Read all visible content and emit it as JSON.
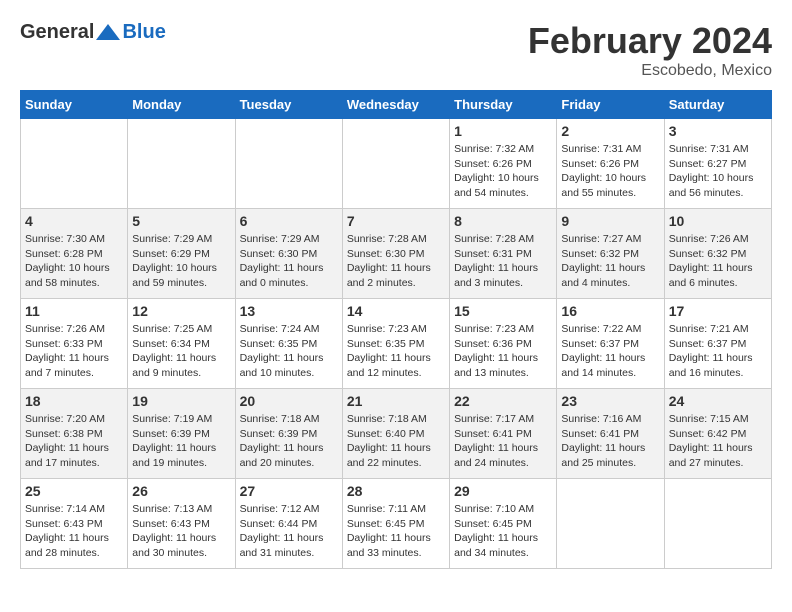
{
  "header": {
    "logo_general": "General",
    "logo_blue": "Blue",
    "month_year": "February 2024",
    "location": "Escobedo, Mexico"
  },
  "days_of_week": [
    "Sunday",
    "Monday",
    "Tuesday",
    "Wednesday",
    "Thursday",
    "Friday",
    "Saturday"
  ],
  "weeks": [
    [
      {
        "day": "",
        "info": ""
      },
      {
        "day": "",
        "info": ""
      },
      {
        "day": "",
        "info": ""
      },
      {
        "day": "",
        "info": ""
      },
      {
        "day": "1",
        "info": "Sunrise: 7:32 AM\nSunset: 6:26 PM\nDaylight: 10 hours and 54 minutes."
      },
      {
        "day": "2",
        "info": "Sunrise: 7:31 AM\nSunset: 6:26 PM\nDaylight: 10 hours and 55 minutes."
      },
      {
        "day": "3",
        "info": "Sunrise: 7:31 AM\nSunset: 6:27 PM\nDaylight: 10 hours and 56 minutes."
      }
    ],
    [
      {
        "day": "4",
        "info": "Sunrise: 7:30 AM\nSunset: 6:28 PM\nDaylight: 10 hours and 58 minutes."
      },
      {
        "day": "5",
        "info": "Sunrise: 7:29 AM\nSunset: 6:29 PM\nDaylight: 10 hours and 59 minutes."
      },
      {
        "day": "6",
        "info": "Sunrise: 7:29 AM\nSunset: 6:30 PM\nDaylight: 11 hours and 0 minutes."
      },
      {
        "day": "7",
        "info": "Sunrise: 7:28 AM\nSunset: 6:30 PM\nDaylight: 11 hours and 2 minutes."
      },
      {
        "day": "8",
        "info": "Sunrise: 7:28 AM\nSunset: 6:31 PM\nDaylight: 11 hours and 3 minutes."
      },
      {
        "day": "9",
        "info": "Sunrise: 7:27 AM\nSunset: 6:32 PM\nDaylight: 11 hours and 4 minutes."
      },
      {
        "day": "10",
        "info": "Sunrise: 7:26 AM\nSunset: 6:32 PM\nDaylight: 11 hours and 6 minutes."
      }
    ],
    [
      {
        "day": "11",
        "info": "Sunrise: 7:26 AM\nSunset: 6:33 PM\nDaylight: 11 hours and 7 minutes."
      },
      {
        "day": "12",
        "info": "Sunrise: 7:25 AM\nSunset: 6:34 PM\nDaylight: 11 hours and 9 minutes."
      },
      {
        "day": "13",
        "info": "Sunrise: 7:24 AM\nSunset: 6:35 PM\nDaylight: 11 hours and 10 minutes."
      },
      {
        "day": "14",
        "info": "Sunrise: 7:23 AM\nSunset: 6:35 PM\nDaylight: 11 hours and 12 minutes."
      },
      {
        "day": "15",
        "info": "Sunrise: 7:23 AM\nSunset: 6:36 PM\nDaylight: 11 hours and 13 minutes."
      },
      {
        "day": "16",
        "info": "Sunrise: 7:22 AM\nSunset: 6:37 PM\nDaylight: 11 hours and 14 minutes."
      },
      {
        "day": "17",
        "info": "Sunrise: 7:21 AM\nSunset: 6:37 PM\nDaylight: 11 hours and 16 minutes."
      }
    ],
    [
      {
        "day": "18",
        "info": "Sunrise: 7:20 AM\nSunset: 6:38 PM\nDaylight: 11 hours and 17 minutes."
      },
      {
        "day": "19",
        "info": "Sunrise: 7:19 AM\nSunset: 6:39 PM\nDaylight: 11 hours and 19 minutes."
      },
      {
        "day": "20",
        "info": "Sunrise: 7:18 AM\nSunset: 6:39 PM\nDaylight: 11 hours and 20 minutes."
      },
      {
        "day": "21",
        "info": "Sunrise: 7:18 AM\nSunset: 6:40 PM\nDaylight: 11 hours and 22 minutes."
      },
      {
        "day": "22",
        "info": "Sunrise: 7:17 AM\nSunset: 6:41 PM\nDaylight: 11 hours and 24 minutes."
      },
      {
        "day": "23",
        "info": "Sunrise: 7:16 AM\nSunset: 6:41 PM\nDaylight: 11 hours and 25 minutes."
      },
      {
        "day": "24",
        "info": "Sunrise: 7:15 AM\nSunset: 6:42 PM\nDaylight: 11 hours and 27 minutes."
      }
    ],
    [
      {
        "day": "25",
        "info": "Sunrise: 7:14 AM\nSunset: 6:43 PM\nDaylight: 11 hours and 28 minutes."
      },
      {
        "day": "26",
        "info": "Sunrise: 7:13 AM\nSunset: 6:43 PM\nDaylight: 11 hours and 30 minutes."
      },
      {
        "day": "27",
        "info": "Sunrise: 7:12 AM\nSunset: 6:44 PM\nDaylight: 11 hours and 31 minutes."
      },
      {
        "day": "28",
        "info": "Sunrise: 7:11 AM\nSunset: 6:45 PM\nDaylight: 11 hours and 33 minutes."
      },
      {
        "day": "29",
        "info": "Sunrise: 7:10 AM\nSunset: 6:45 PM\nDaylight: 11 hours and 34 minutes."
      },
      {
        "day": "",
        "info": ""
      },
      {
        "day": "",
        "info": ""
      }
    ]
  ]
}
